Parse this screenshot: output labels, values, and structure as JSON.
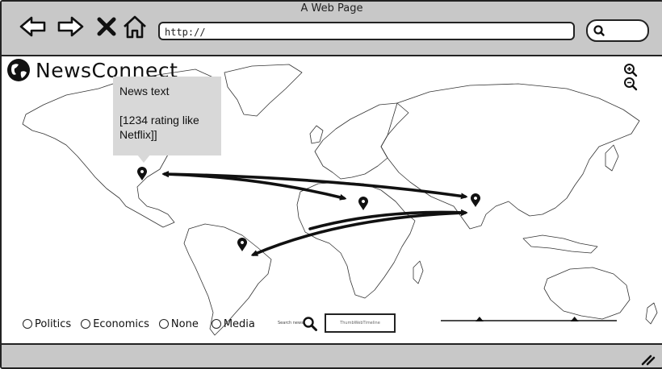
{
  "window": {
    "title": "A Web Page"
  },
  "toolbar": {
    "back_icon": "arrow-left-icon",
    "forward_icon": "arrow-right-icon",
    "stop_icon": "close-icon",
    "home_icon": "home-icon",
    "url": "http://",
    "search_icon": "search-icon"
  },
  "app": {
    "brand": "NewsConnect",
    "logo_icon": "globe-icon"
  },
  "map": {
    "zoom_in_icon": "zoom-in-icon",
    "zoom_out_icon": "zoom-out-icon",
    "markers": [
      "north-america",
      "europe-africa",
      "south-asia",
      "south-america"
    ],
    "connections": 4
  },
  "tooltip": {
    "line1": "News text",
    "line2": "[1234 rating like",
    "line3": "Netflix]]"
  },
  "filters": [
    {
      "label": "Politics"
    },
    {
      "label": "Economics"
    },
    {
      "label": "None"
    },
    {
      "label": "Media"
    }
  ],
  "search": {
    "scribble": "Search news",
    "thumb_text": "ThumbWebTimeline"
  },
  "timeline": {
    "handles": [
      0.22,
      0.76
    ]
  },
  "colors": {
    "chrome": "#c8c8c8",
    "ink": "#111111",
    "tooltip": "#d8d8d8"
  }
}
